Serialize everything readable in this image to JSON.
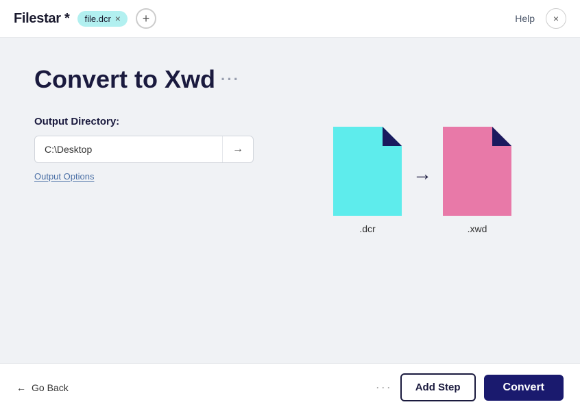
{
  "header": {
    "app_title": "Filestar *",
    "file_tag": "file.dcr",
    "file_tag_close": "×",
    "add_file_label": "+",
    "help_label": "Help",
    "close_label": "×"
  },
  "main": {
    "page_title": "Convert to Xwd",
    "page_title_dots": "···",
    "output_dir_label": "Output Directory:",
    "output_dir_value": "C:\\Desktop",
    "output_dir_arrow": "→",
    "output_options_label": "Output Options"
  },
  "illustration": {
    "source_label": ".dcr",
    "target_label": ".xwd",
    "arrow": "→",
    "source_color": "#5eecec",
    "target_color": "#e879a8",
    "corner_color": "#1a1a5e"
  },
  "footer": {
    "go_back_label": "Go Back",
    "more_dots": "···",
    "add_step_label": "Add Step",
    "convert_label": "Convert"
  }
}
